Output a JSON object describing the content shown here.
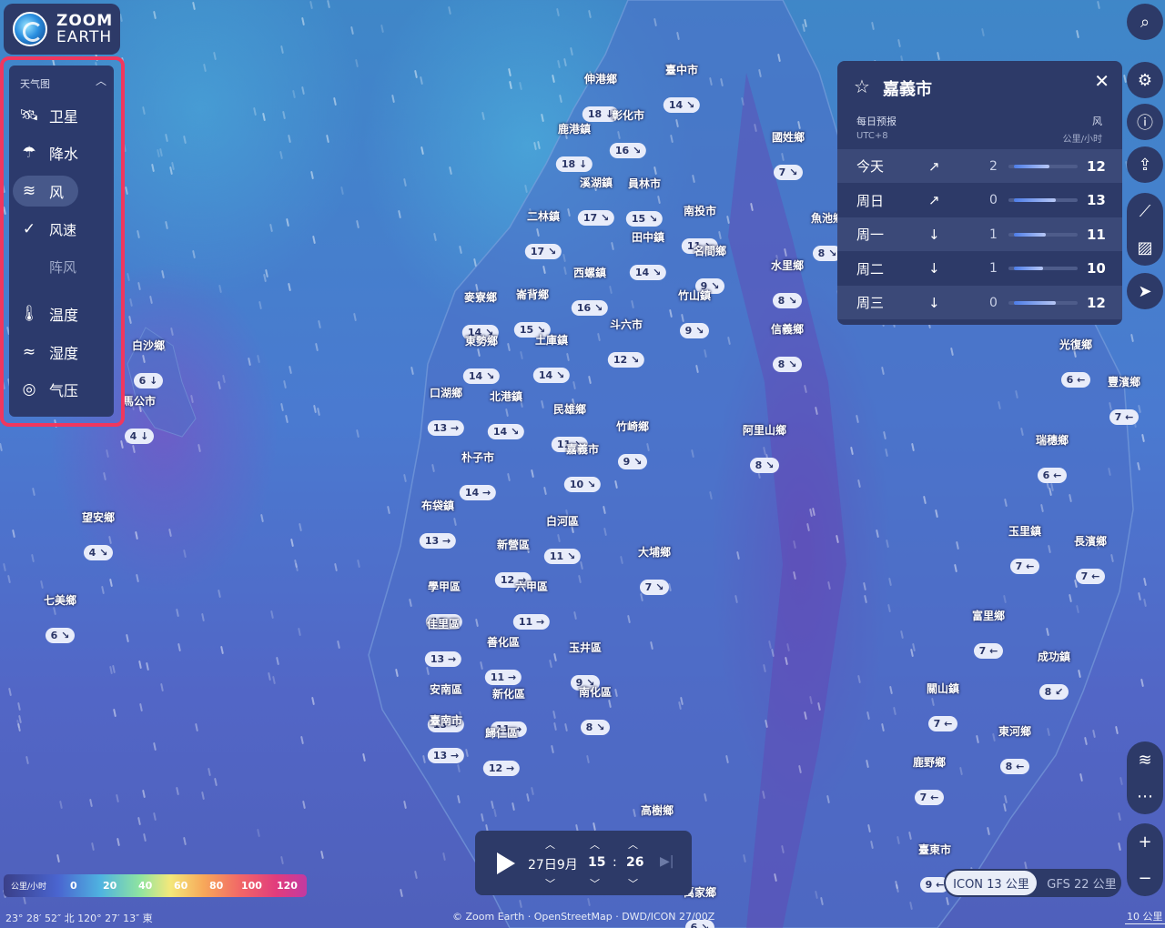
{
  "logo": {
    "line1": "ZOOM",
    "line2": "EARTH"
  },
  "layers": {
    "heading": "天气图",
    "items": [
      {
        "icon": "satellite-icon",
        "label": "卫星"
      },
      {
        "icon": "precipitation-icon",
        "label": "降水"
      },
      {
        "icon": "wind-icon",
        "label": "风",
        "active": true
      },
      {
        "icon": "check-icon",
        "label": "风速",
        "sub": true
      },
      {
        "icon": "",
        "label": "阵风",
        "sub": true
      },
      {
        "icon": "thermometer-icon",
        "label": "温度"
      },
      {
        "icon": "humidity-icon",
        "label": "湿度"
      },
      {
        "icon": "pressure-icon",
        "label": "气压"
      }
    ]
  },
  "forecast": {
    "title": "嘉義市",
    "label_daily": "每日预报",
    "timezone": "UTC+8",
    "label_metric": "风",
    "unit": "公里/小时",
    "rows": [
      {
        "day": "今天",
        "arrow": "↗",
        "min": "2",
        "max": "12",
        "fill": 0.55
      },
      {
        "day": "周日",
        "arrow": "↗",
        "min": "0",
        "max": "13",
        "fill": 0.65
      },
      {
        "day": "周一",
        "arrow": "↓",
        "min": "1",
        "max": "11",
        "fill": 0.5
      },
      {
        "day": "周二",
        "arrow": "↓",
        "min": "1",
        "max": "10",
        "fill": 0.45
      },
      {
        "day": "周三",
        "arrow": "↓",
        "min": "0",
        "max": "12",
        "fill": 0.65
      }
    ]
  },
  "timebar": {
    "date": "27日9月",
    "hour": "15",
    "minute": "26"
  },
  "legend": {
    "unit": "公里/小时",
    "ticks": [
      "0",
      "20",
      "40",
      "60",
      "80",
      "100",
      "120"
    ]
  },
  "coords": "23° 28′ 52″ 北  120° 27′ 13″ 東",
  "attribution": "© Zoom Earth · OpenStreetMap · DWD/ICON 27/00Z",
  "scale": "10 公里",
  "models": {
    "active": "ICON 13 公里",
    "inactive": "GFS 22 公里"
  },
  "places": [
    {
      "name": "伸港鄉",
      "speed": "18 ↓"
    },
    {
      "name": "臺中市",
      "speed": "14 ↘"
    },
    {
      "name": "鹿港鎮",
      "speed": "18 ↓"
    },
    {
      "name": "彰化市",
      "speed": "16 ↘"
    },
    {
      "name": "國姓鄉",
      "speed": "7 ↘"
    },
    {
      "name": "溪湖鎮",
      "speed": "17 ↘"
    },
    {
      "name": "員林市",
      "speed": "15 ↘"
    },
    {
      "name": "二林鎮",
      "speed": "17 ↘"
    },
    {
      "name": "南投市",
      "speed": "11 ↘"
    },
    {
      "name": "魚池鄉",
      "speed": "8 ↘"
    },
    {
      "name": "田中鎮",
      "speed": "14 ↘"
    },
    {
      "name": "名間鄉",
      "speed": "9 ↘"
    },
    {
      "name": "西螺鎮",
      "speed": "16 ↘"
    },
    {
      "name": "水里鄉",
      "speed": "8 ↘"
    },
    {
      "name": "麥寮鄉",
      "speed": "14 ↘"
    },
    {
      "name": "崙背鄉",
      "speed": "15 ↘"
    },
    {
      "name": "竹山鎮",
      "speed": "9 ↘"
    },
    {
      "name": "斗六市",
      "speed": "12 ↘"
    },
    {
      "name": "信義鄉",
      "speed": "8 ↘"
    },
    {
      "name": "白沙鄉",
      "speed": "6 ↓"
    },
    {
      "name": "東勢鄉",
      "speed": "14 ↘"
    },
    {
      "name": "土庫鎮",
      "speed": "14 ↘"
    },
    {
      "name": "光復鄉",
      "speed": "6 ←"
    },
    {
      "name": "豐濱鄉",
      "speed": "7 ←"
    },
    {
      "name": "馬公市",
      "speed": "4 ↓"
    },
    {
      "name": "口湖鄉",
      "speed": "13 →"
    },
    {
      "name": "北港鎮",
      "speed": "14 ↘"
    },
    {
      "name": "民雄鄉",
      "speed": "11 ↘"
    },
    {
      "name": "竹崎鄉",
      "speed": "9 ↘"
    },
    {
      "name": "阿里山鄉",
      "speed": "8 ↘"
    },
    {
      "name": "嘉義市",
      "speed": "10 ↘"
    },
    {
      "name": "瑞穗鄉",
      "speed": "6 ←"
    },
    {
      "name": "朴子市",
      "speed": "14 →"
    },
    {
      "name": "布袋鎮",
      "speed": "13 →"
    },
    {
      "name": "白河區",
      "speed": "11 ↘"
    },
    {
      "name": "望安鄉",
      "speed": "4 ↘"
    },
    {
      "name": "新營區",
      "speed": "12 →"
    },
    {
      "name": "大埔鄉",
      "speed": "7 ↘"
    },
    {
      "name": "玉里鎮",
      "speed": "7 ←"
    },
    {
      "name": "長濱鄉",
      "speed": "7 ←"
    },
    {
      "name": "學甲區",
      "speed": "13 →"
    },
    {
      "name": "六甲區",
      "speed": "11 →"
    },
    {
      "name": "七美鄉",
      "speed": "6 ↘"
    },
    {
      "name": "佳里區",
      "speed": "13 →"
    },
    {
      "name": "富里鄉",
      "speed": "7 ←"
    },
    {
      "name": "善化區",
      "speed": "11 →"
    },
    {
      "name": "玉井區",
      "speed": "9 ↘"
    },
    {
      "name": "成功鎮",
      "speed": "8 ↙"
    },
    {
      "name": "安南區",
      "speed": "13 →"
    },
    {
      "name": "新化區",
      "speed": "11 →"
    },
    {
      "name": "南化區",
      "speed": "8 ↘"
    },
    {
      "name": "關山鎮",
      "speed": "7 ←"
    },
    {
      "name": "臺南市",
      "speed": "13 →"
    },
    {
      "name": "歸仁區",
      "speed": "12 →"
    },
    {
      "name": "東河鄉",
      "speed": "8 ←"
    },
    {
      "name": "鹿野鄉",
      "speed": "7 ←"
    },
    {
      "name": "高樹鄉",
      "speed": "9 ↘"
    },
    {
      "name": "臺東市",
      "speed": "9 ←"
    },
    {
      "name": "萬家鄉",
      "speed": "6 ↘"
    }
  ]
}
